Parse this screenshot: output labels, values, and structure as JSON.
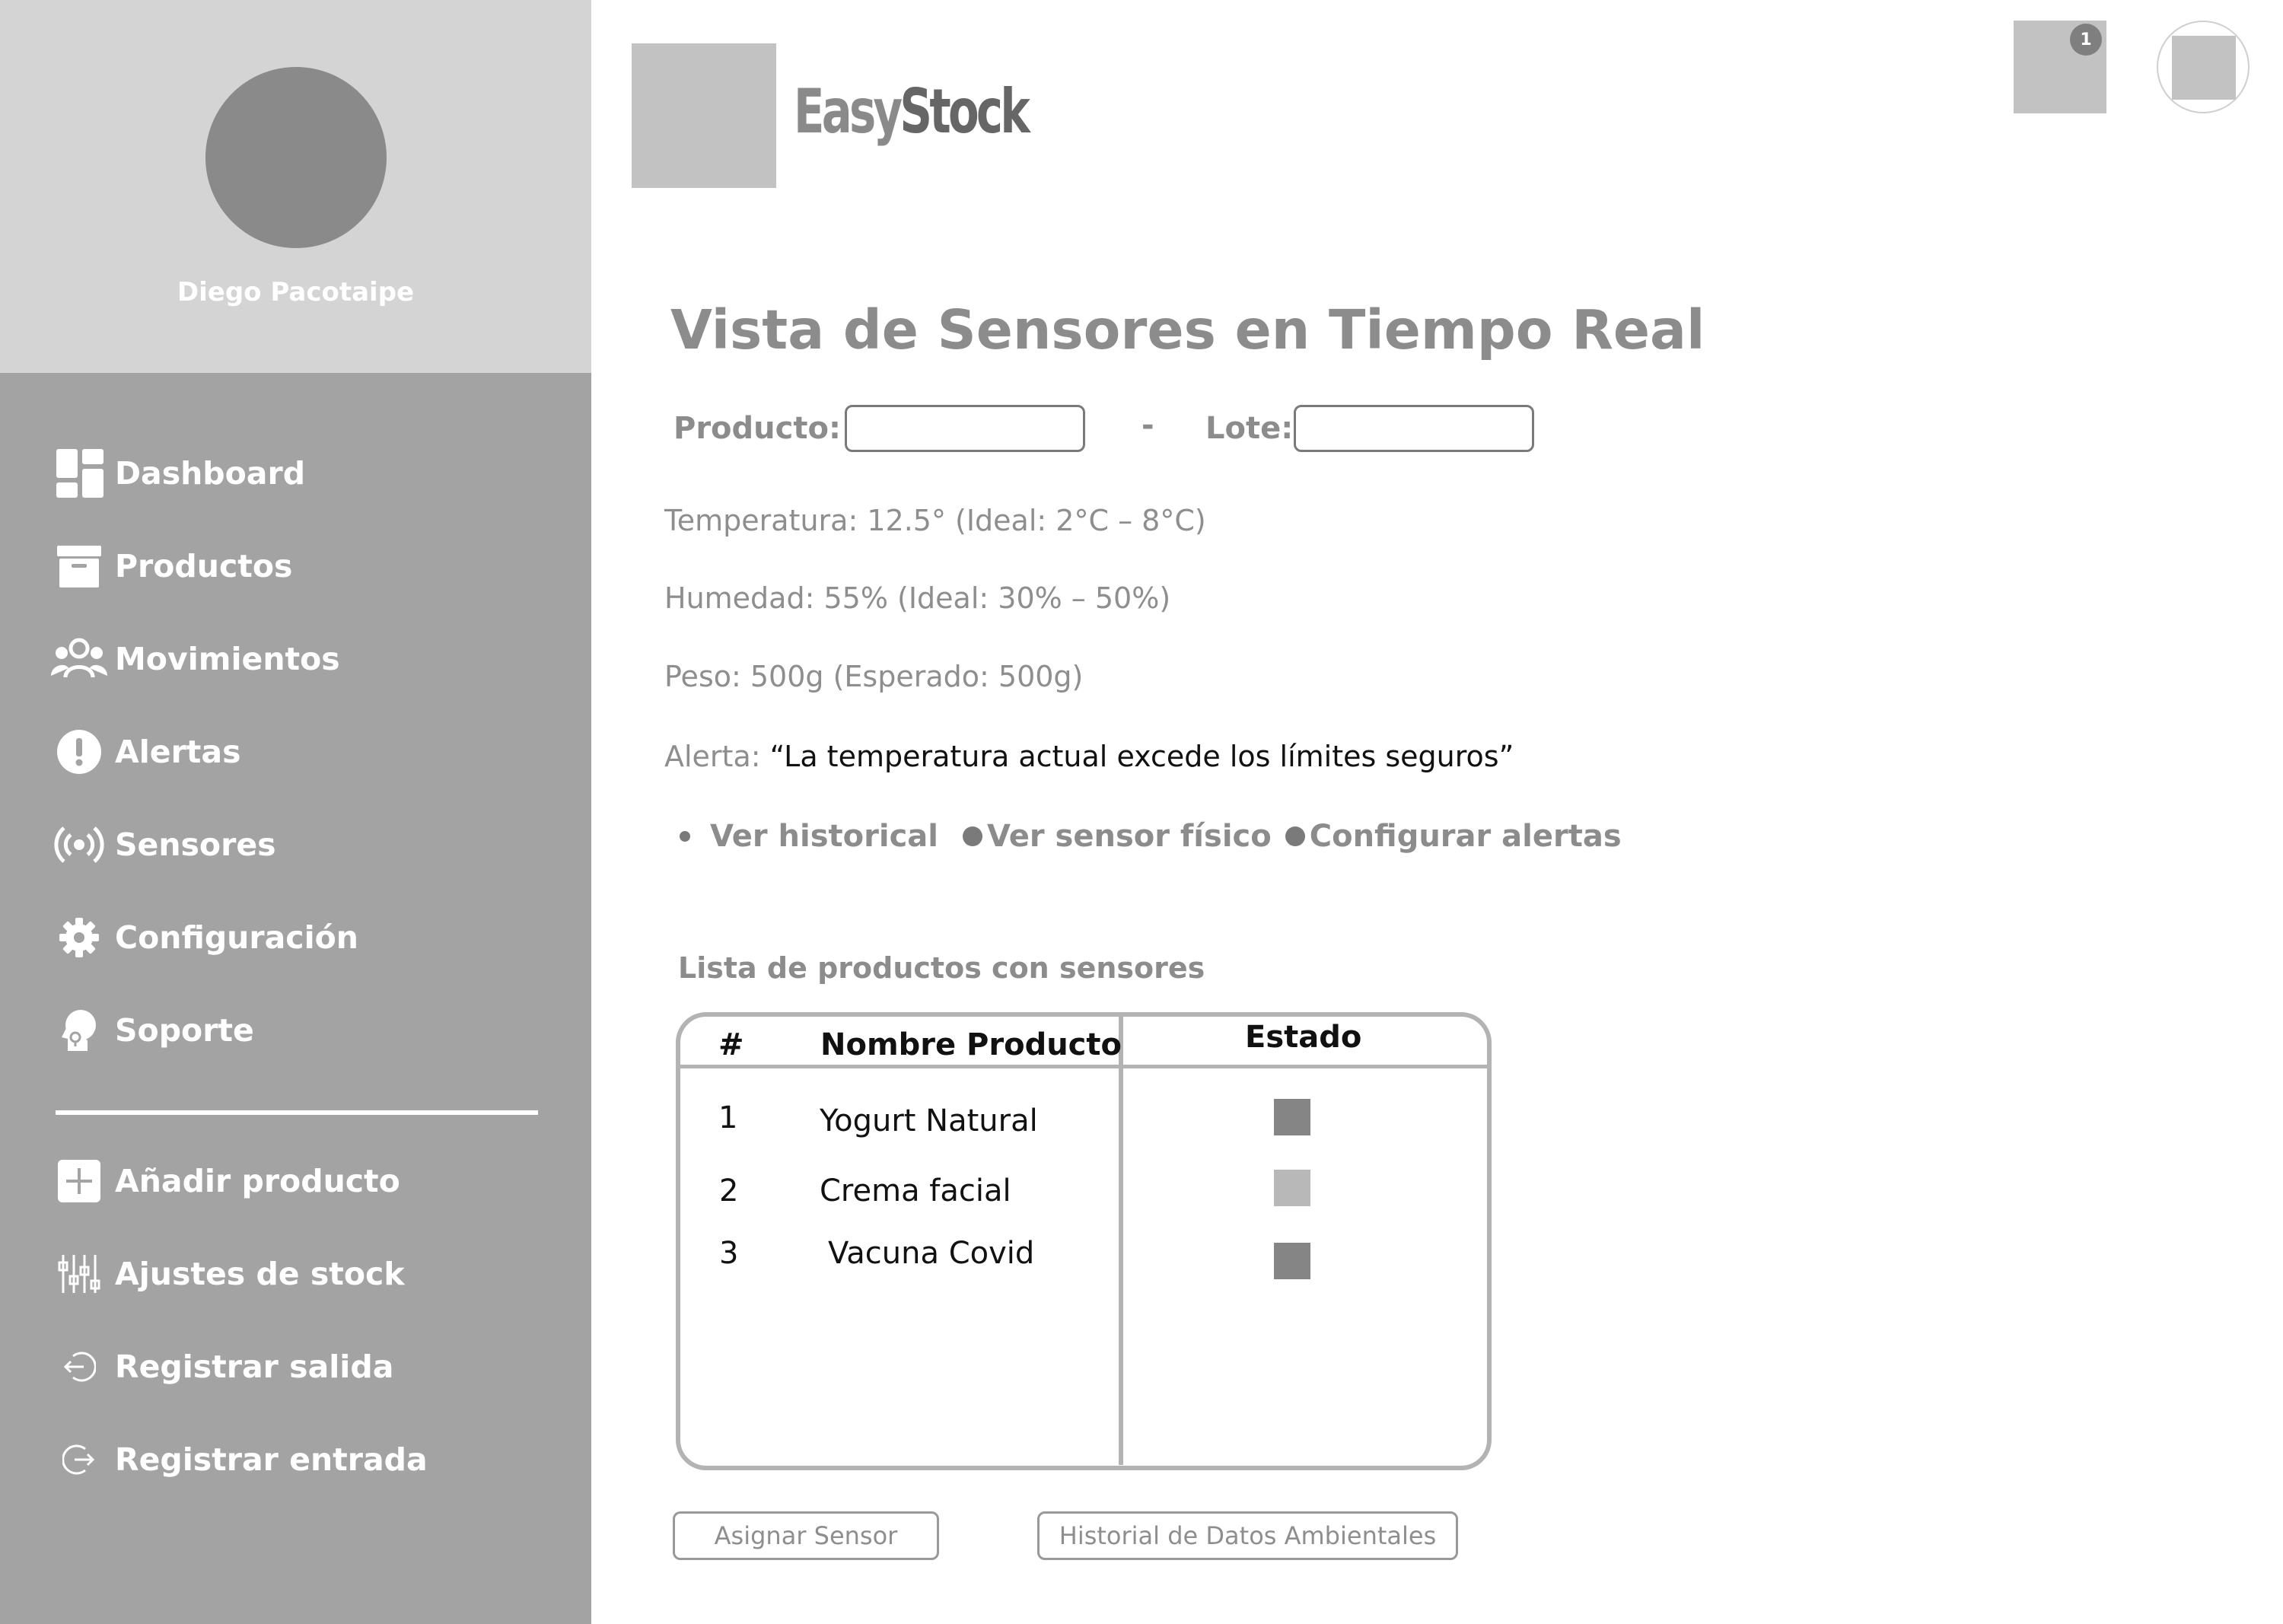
{
  "brand": {
    "easy": "Easy",
    "stock": "Stock"
  },
  "header": {
    "notification_count": "1"
  },
  "profile": {
    "name": "Diego Pacotaipe"
  },
  "sidebar": {
    "items": [
      {
        "label": "Dashboard",
        "icon": "dashboard-icon"
      },
      {
        "label": "Productos",
        "icon": "archive-box-icon"
      },
      {
        "label": "Movimientos",
        "icon": "users-group-icon"
      },
      {
        "label": "Alertas",
        "icon": "exclamation-circle-icon"
      },
      {
        "label": "Sensores",
        "icon": "broadcast-icon"
      },
      {
        "label": "Configuración",
        "icon": "gear-icon"
      },
      {
        "label": "Soporte",
        "icon": "headset-icon"
      }
    ],
    "secondary_items": [
      {
        "label": "Añadir producto",
        "icon": "plus-square-icon"
      },
      {
        "label": "Ajustes de stock",
        "icon": "sliders-icon"
      },
      {
        "label": "Registrar salida",
        "icon": "sign-out-icon"
      },
      {
        "label": "Registrar entrada",
        "icon": "sign-in-icon"
      }
    ]
  },
  "main": {
    "title": "Vista de Sensores en Tiempo Real",
    "filters": {
      "product_label": "Producto:",
      "product_value": "",
      "separator": "-",
      "lot_label": "Lote:",
      "lot_value": ""
    },
    "readings": {
      "temperature": "Temperatura: 12.5° (Ideal: 2°C – 8°C)",
      "humidity": "Humedad: 55% (Ideal: 30% – 50%)",
      "weight": "Peso: 500g (Esperado: 500g)",
      "alert_label": "Alerta: ",
      "alert_message": "“La temperatura actual excede los límites seguros”"
    },
    "actions": [
      "Ver historical",
      "Ver sensor físico",
      "Configurar alertas"
    ],
    "list_title": "Lista de productos con sensores",
    "table": {
      "headers": {
        "number": "#",
        "name": "Nombre Producto",
        "status": "Estado"
      },
      "rows": [
        {
          "number": "1",
          "name": "Yogurt Natural",
          "status_color": "#858585"
        },
        {
          "number": "2",
          "name": "Crema facial",
          "status_color": "#b8b8b8"
        },
        {
          "number": "3",
          "name": "Vacuna Covid",
          "status_color": "#858585"
        }
      ]
    },
    "buttons": {
      "assign_sensor": "Asignar Sensor",
      "history": "Historial de Datos Ambientales"
    }
  },
  "colors": {
    "sidebar_bg": "#a3a3a3",
    "profile_bg": "#d4d4d4",
    "placeholder_gray": "#c2c2c2",
    "text_gray": "#8c8c8c"
  }
}
